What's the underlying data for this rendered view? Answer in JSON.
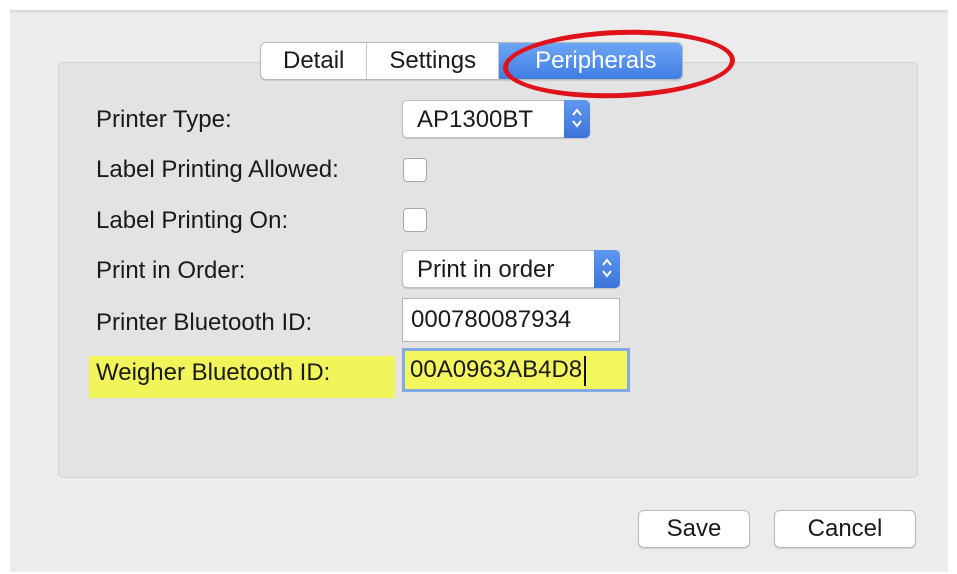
{
  "tabs": [
    {
      "label": "Detail"
    },
    {
      "label": "Settings"
    },
    {
      "label": "Peripherals"
    }
  ],
  "active_tab": "Peripherals",
  "form": {
    "printer_type_label": "Printer Type:",
    "printer_type_value": "AP1300BT",
    "label_printing_allowed_label": "Label Printing Allowed:",
    "label_printing_allowed_checked": false,
    "label_printing_on_label": "Label Printing On:",
    "label_printing_on_checked": false,
    "print_in_order_label": "Print in Order:",
    "print_in_order_value": "Print in order",
    "printer_bt_label": "Printer Bluetooth ID:",
    "printer_bt_value": "000780087934",
    "weigher_bt_label": "Weigher Bluetooth ID:",
    "weigher_bt_value": "00A0963AB4D8"
  },
  "buttons": {
    "save": "Save",
    "cancel": "Cancel"
  },
  "colors": {
    "accent": "#3f7de3",
    "annotation_ring": "#e0121a",
    "highlight": "#f1f55a"
  },
  "icons": {
    "popup_stepper": "up-down-chevron-icon"
  }
}
